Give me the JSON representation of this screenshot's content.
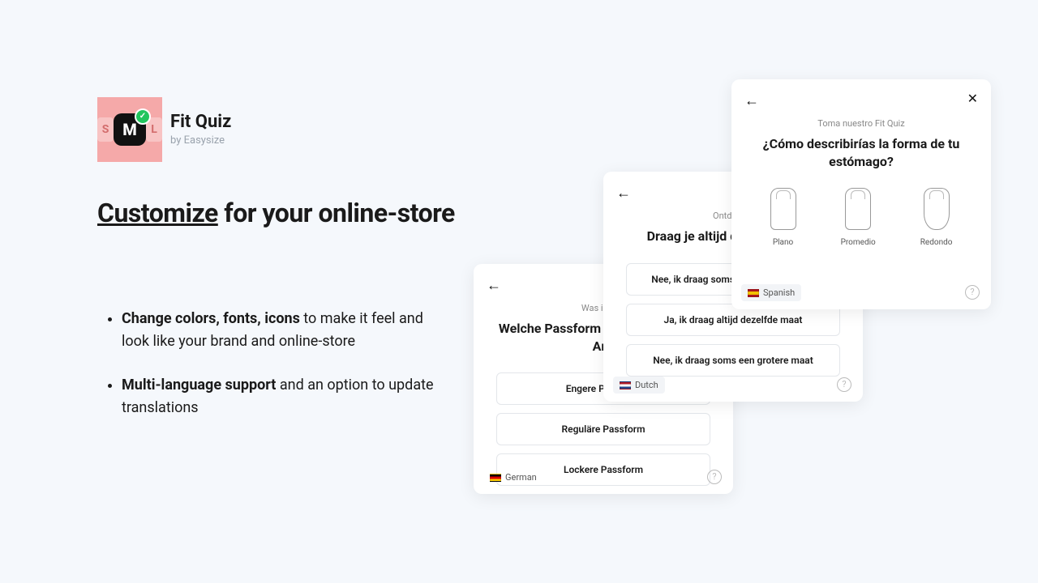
{
  "logo": {
    "s": "S",
    "m": "M",
    "l": "L"
  },
  "app": {
    "name": "Fit Quiz",
    "vendor": "by Easysize"
  },
  "headline": {
    "underlined": "Customize",
    "rest": " for your online-store"
  },
  "bullets": {
    "b1_strong": "Change colors, fonts, icons",
    "b1_rest": " to make it feel and look like your brand and online-store",
    "b2_strong": "Multi-language support",
    "b2_rest": " and an option to update translations"
  },
  "card_de": {
    "kicker": "Was ist me",
    "question": "Welche Passform bevorzugst du bei Arti",
    "options": [
      "Engere Passform",
      "Reguläre Passform",
      "Lockere Passform"
    ],
    "lang": "German"
  },
  "card_nl": {
    "kicker": "Ontdek on",
    "question": "Draag je altijd dezelfde maat?",
    "options": [
      "Nee, ik draag soms een kleinere maat",
      "Ja, ik draag altijd dezelfde maat",
      "Nee, ik draag soms een grotere maat"
    ],
    "lang": "Dutch"
  },
  "card_es": {
    "kicker": "Toma nuestro Fit Quiz",
    "question": "¿Cómo describirías la forma de tu estómago?",
    "shapes": [
      "Plano",
      "Promedio",
      "Redondo"
    ],
    "lang": "Spanish"
  }
}
